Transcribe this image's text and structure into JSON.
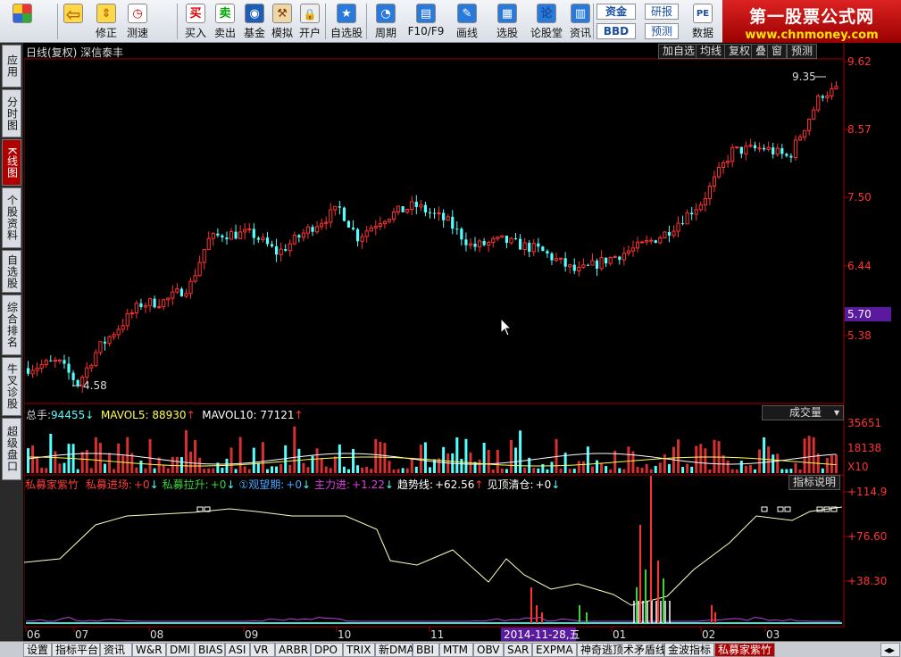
{
  "toolbar": {
    "buttons": [
      {
        "label": "",
        "icon": "app-grid-icon"
      },
      {
        "label": "",
        "icon": "back-arrow-icon"
      },
      {
        "label": "修正",
        "icon": "up-down-arrow-icon"
      },
      {
        "label": "测速",
        "icon": "speed-test-icon"
      },
      {
        "label": "买入",
        "icon": "buy-icon",
        "glyph": "买"
      },
      {
        "label": "卖出",
        "icon": "sell-icon",
        "glyph": "卖"
      },
      {
        "label": "基金",
        "icon": "fund-icon"
      },
      {
        "label": "模拟",
        "icon": "hammer-icon"
      },
      {
        "label": "开户",
        "icon": "lock-icon"
      },
      {
        "label": "自选股",
        "icon": "star-icon"
      },
      {
        "label": "周期",
        "icon": "clock-icon"
      },
      {
        "label": "F10/F9",
        "icon": "f10-icon"
      },
      {
        "label": "画线",
        "icon": "pen-icon"
      },
      {
        "label": "选股",
        "icon": "select-stock-icon"
      },
      {
        "label": "论股堂",
        "icon": "forum-icon",
        "glyph": "论"
      },
      {
        "label": "资讯",
        "icon": "news-icon"
      },
      {
        "label": "资金",
        "icon": "capital-icon"
      },
      {
        "label": "BBD",
        "icon": "bbd-icon"
      },
      {
        "label": "研报",
        "icon": "report-icon"
      },
      {
        "label": "预测",
        "icon": "forecast-icon"
      },
      {
        "label": "数据",
        "icon": "data-icon"
      }
    ],
    "logo_line1": "第一股票公式网",
    "logo_line2": "www.chnmoney.com"
  },
  "left_tabs": [
    "应用",
    "分时图",
    "K线图",
    "个股资料",
    "自选股",
    "综合排名",
    "牛叉诊股",
    "超级盘口"
  ],
  "chart_header": {
    "title": "日线(复权)  深信泰丰",
    "buttons": [
      "加自选",
      "均线",
      "复权",
      "叠",
      "窗",
      "预测"
    ]
  },
  "price_axis": [
    "9.62",
    "8.57",
    "7.50",
    "6.44",
    "5.70",
    "5.38"
  ],
  "price_marks": {
    "high": "9.35",
    "low": "4.58",
    "current": "5.70"
  },
  "volume_header": {
    "total_label": "总手:",
    "total_value": "94455",
    "ma5_label": "MAVOL5:",
    "ma5_value": "88930",
    "ma10_label": "MAVOL10:",
    "ma10_value": "77121",
    "dropdown": "成交量"
  },
  "volume_axis": [
    "35651",
    "18138",
    "X10"
  ],
  "indicator_header": {
    "name": "私募家紫竹",
    "items": [
      {
        "label": "私募进场:",
        "value": "+0",
        "color": "#ff3b3b"
      },
      {
        "label": "私募拉升:",
        "value": "+0",
        "color": "#3bd33b"
      },
      {
        "label": "①观望期:",
        "value": "+0",
        "color": "#4da6ff"
      },
      {
        "label": "主力进:",
        "value": "+1.22",
        "color": "#e040e0"
      },
      {
        "label": "趋势线:",
        "value": "+62.56",
        "color": "#ffffff"
      },
      {
        "label": "见顶清仓:",
        "value": "+0",
        "color": "#ffffff"
      }
    ],
    "explain_button": "指标说明"
  },
  "indicator_axis": [
    "+114.9",
    "+76.60",
    "+38.30"
  ],
  "time_axis": [
    "06",
    "07",
    "08",
    "09",
    "10",
    "11",
    "01",
    "02",
    "03"
  ],
  "cursor_date": "2014-11-28,五",
  "bottom_tabs": [
    "设置",
    "指标平台",
    "资讯",
    "W&R",
    "DMI",
    "BIAS",
    "ASI",
    "VR",
    "ARBR",
    "DPO",
    "TRIX",
    "新DMA",
    "BBI",
    "MTM",
    "OBV",
    "SAR",
    "EXPMA",
    "神奇逃顶术矛盾线",
    "金波指标",
    "私募家紫竹"
  ],
  "colors": {
    "up": "#ff3232",
    "down": "#54ffff",
    "axis": "#a00000",
    "grid": "#7a0000"
  }
}
